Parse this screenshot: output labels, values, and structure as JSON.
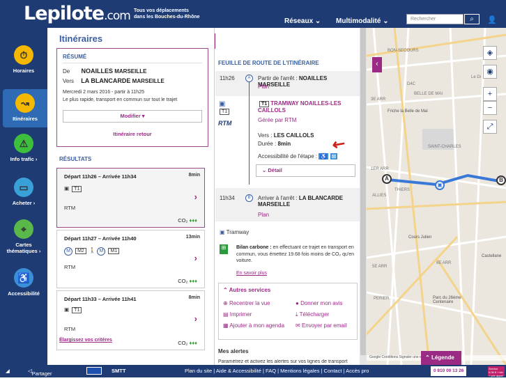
{
  "header": {
    "logo": "Lepilote",
    "logo_suffix": ".com",
    "tagline1": "Tous vos déplacements",
    "tagline2": "dans les Bouches-du-Rhône",
    "nav": [
      "Réseaux",
      "Multimodalité"
    ],
    "search_placeholder": "Rechercher"
  },
  "sidebar": [
    {
      "label": "Horaires",
      "icon": "clock-icon"
    },
    {
      "label": "Itinéraires",
      "icon": "route-icon"
    },
    {
      "label": "Info trafic ›",
      "icon": "warning-icon"
    },
    {
      "label": "Acheter ›",
      "icon": "ticket-icon"
    },
    {
      "label": "Cartes thématiques ›",
      "icon": "map-pin-icon"
    },
    {
      "label": "Accessibilité",
      "icon": "wheelchair-icon"
    }
  ],
  "left": {
    "title": "Itinéraires",
    "resume_title": "RÉSUMÉ",
    "de_label": "De",
    "de_value": "NOAILLES",
    "de_city": "MARSEILLE",
    "vers_label": "Vers",
    "vers_value": "LA BLANCARDE",
    "vers_city": "MARSEILLE",
    "date": "Mercredi 2 mars 2016 - partir à 11h25",
    "mode": "Le plus rapide, transport en commun sur tout le trajet",
    "modify": "Modifier ▾",
    "return": "Itinéraire retour",
    "results_title": "RÉSULTATS",
    "cards": [
      {
        "time": "Départ 11h26 – Arrivée 11h34",
        "dur": "8min",
        "op": "RTM",
        "co2": "CO₂"
      },
      {
        "time": "Départ 11h27 – Arrivée 11h40",
        "dur": "13min",
        "op": "RTM",
        "co2": "CO₂"
      },
      {
        "time": "Départ 11h33 – Arrivée 11h41",
        "dur": "8min",
        "op": "RTM",
        "co2": "CO₂"
      }
    ],
    "line_t1": "T1",
    "line_m2": "M2",
    "line_m1": "M1",
    "metro": "M",
    "leaves": "♦♦♦",
    "widen": "Élargissez vos critères"
  },
  "mid": {
    "title": "FEUILLE DE ROUTE DE L'ITINÉRAIRE",
    "dep_time": "11h26",
    "dep_label": "Partir de l'arrêt :",
    "dep_stop": "NOAILLES",
    "dep_city": "MARSEILLE",
    "plan": "Plan",
    "line": "T1",
    "line_name": "TRAMWAY NOAILLES-LES CAILLOLS",
    "operator": "Gérée par RTM",
    "rtm": "RTM",
    "dir_label": "Vers :",
    "dir": "LES CAILLOLS",
    "dur_label": "Durée :",
    "dur": "8min",
    "access": "Accessibilité de l'étape :",
    "detail": "Détail",
    "arr_time": "11h34",
    "arr_label": "Arriver à l'arrêt :",
    "arr_stop": "LA BLANCARDE",
    "arr_city": "MARSEILLE",
    "mode": "Tramway",
    "carbon_title": "Bilan carbone :",
    "carbon_text": "en effectuant ce trajet en transport en commun, vous émettez 19.68 fois moins de CO₂ qu'en voiture.",
    "more": "En savoir plus",
    "services": "Autres services",
    "recenter": "Recentrer la vue",
    "opinion": "Donner mon avis",
    "print": "Imprimer",
    "download": "Télécharger",
    "agenda": "Ajouter à mon agenda",
    "email": "Envoyer par email",
    "alerts": "Mes alertes",
    "alerts_text": "Paramétrez et activez les alertes sur vos lignes de transport"
  },
  "map": {
    "labels": [
      "BON-SECOURS",
      "BELLE DE MAI",
      "3E ARR",
      "Friche la Belle de Mai",
      "SAINT-CHARLES",
      "1ER ARR",
      "THIERS",
      "ALLIES",
      "Cours Julien",
      "6E ARR",
      "Castellane",
      "PERIER",
      "Parc du 26ème Centenaire",
      "5E ARR",
      "D4C",
      "Le Di"
    ],
    "stop_a": "A",
    "stop_b": "B",
    "legend": "Légende",
    "copyright": "Google Conditions Signaler une erreur Leaflet"
  },
  "footer": {
    "share": "Partager la page",
    "links": "Plan du site | Aide & Accessibilité | FAQ | Mentions légales | Contact | Accès pro",
    "phone": "0 810 00 13 26",
    "service": "Service 0,06 € / min + prix appel"
  }
}
